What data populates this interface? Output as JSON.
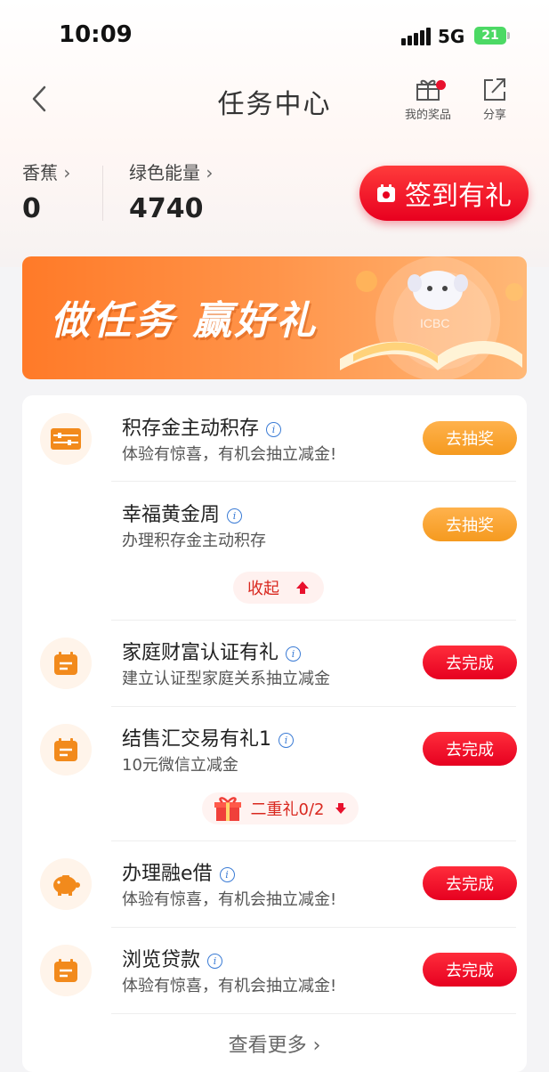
{
  "status_bar": {
    "time": "10:09",
    "network": "5G",
    "battery": "21"
  },
  "nav": {
    "title": "任务中心",
    "prizes_label": "我的奖品",
    "share_label": "分享"
  },
  "stats": {
    "banana_label": "香蕉",
    "banana_value": "0",
    "energy_label": "绿色能量",
    "energy_value": "4740",
    "signin_label": "签到有礼"
  },
  "banner": {
    "text": "做任务 赢好礼",
    "logo": "ICBC"
  },
  "tasks": [
    {
      "title": "积存金主动积存",
      "desc": "体验有惊喜，有机会抽立减金!",
      "button": "去抽奖",
      "icon": "abacus-icon"
    },
    {
      "title": "幸福黄金周",
      "desc": "办理积存金主动积存",
      "button": "去抽奖"
    },
    {
      "title": "家庭财富认证有礼",
      "desc": "建立认证型家庭关系抽立减金",
      "button": "去完成",
      "icon": "calendar-icon"
    },
    {
      "title": "结售汇交易有礼1",
      "desc": "10元微信立减金",
      "button": "去完成",
      "icon": "calendar-icon"
    },
    {
      "title": "办理融e借",
      "desc": "体验有惊喜，有机会抽立减金!",
      "button": "去完成",
      "icon": "piggy-bank-icon"
    },
    {
      "title": "浏览贷款",
      "desc": "体验有惊喜，有机会抽立减金!",
      "button": "去完成",
      "icon": "calendar-icon"
    }
  ],
  "collapse_label": "收起",
  "double_gift_label": "二重礼0/2",
  "view_more_label": "查看更多",
  "colors": {
    "primary_red": "#e60020",
    "orange": "#f59a1f",
    "icon_orange": "#f28a1c"
  }
}
